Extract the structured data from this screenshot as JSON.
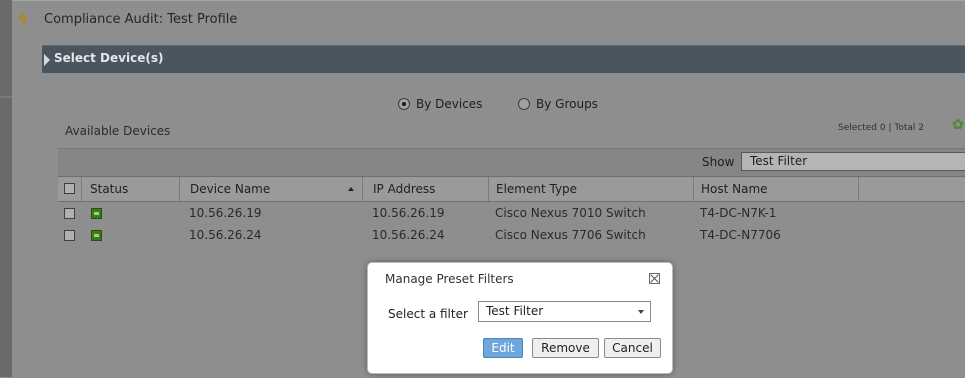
{
  "window": {
    "title": "Compliance Audit: Test Profile",
    "section_title": "Select Device(s)"
  },
  "selection_mode": {
    "options": [
      {
        "label": "By Devices",
        "selected": true
      },
      {
        "label": "By Groups",
        "selected": false
      }
    ]
  },
  "available": {
    "label": "Available Devices",
    "selected_info": "Selected 0 | Total 2"
  },
  "filter_bar": {
    "show_label": "Show",
    "selected_filter": "Test Filter"
  },
  "table": {
    "columns": [
      "Status",
      "Device Name",
      "IP Address",
      "Element Type",
      "Host Name"
    ],
    "sort_column": "Device Name",
    "rows": [
      {
        "status": "ok",
        "device_name": "10.56.26.19",
        "ip_address": "10.56.26.19",
        "element_type": "Cisco Nexus 7010 Switch",
        "host_name": "T4-DC-N7K-1"
      },
      {
        "status": "ok",
        "device_name": "10.56.26.24",
        "ip_address": "10.56.26.24",
        "element_type": "Cisco Nexus 7706 Switch",
        "host_name": "T4-DC-N7706"
      }
    ]
  },
  "dialog": {
    "title": "Manage Preset Filters",
    "select_label": "Select a filter",
    "selected_filter": "Test Filter",
    "buttons": {
      "edit": "Edit",
      "remove": "Remove",
      "cancel": "Cancel"
    }
  },
  "colors": {
    "section_bar": "#4a5560",
    "status_ok": "#3a7a1a",
    "primary_button": "#6fa7dd",
    "overlay": "#8e8e8e"
  }
}
